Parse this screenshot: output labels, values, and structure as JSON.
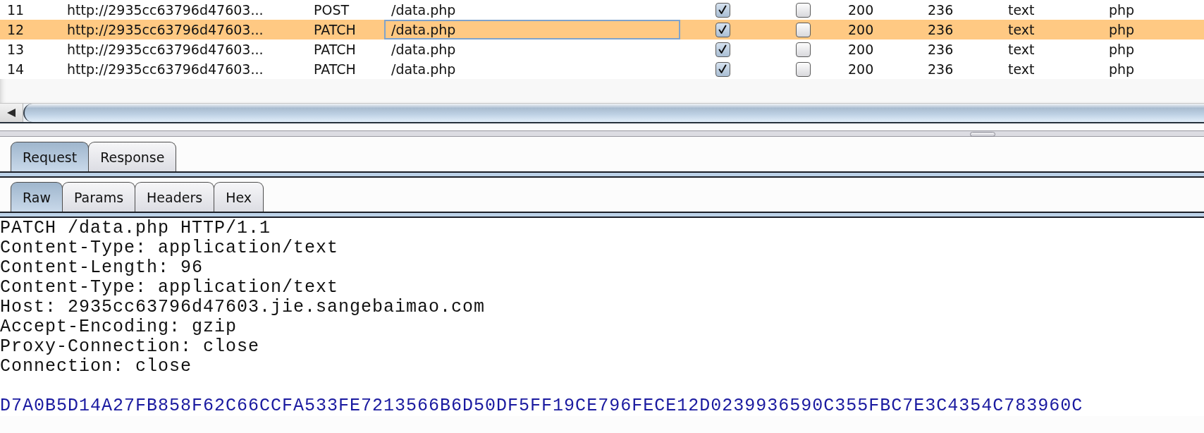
{
  "table": {
    "rows": [
      {
        "selected": false,
        "cells": [
          {
            "kind": "text",
            "text": "11",
            "focused": false
          },
          {
            "kind": "text",
            "text": "http://2935cc63796d47603...",
            "focused": false
          },
          {
            "kind": "text",
            "text": "POST",
            "focused": false
          },
          {
            "kind": "text",
            "text": "/data.php",
            "focused": false
          },
          {
            "kind": "checkbox",
            "checked": true
          },
          {
            "kind": "checkbox",
            "checked": false
          },
          {
            "kind": "text",
            "text": "200",
            "focused": false
          },
          {
            "kind": "text",
            "text": "236",
            "focused": false
          },
          {
            "kind": "text",
            "text": "text",
            "focused": false
          },
          {
            "kind": "text",
            "text": "php",
            "focused": false
          }
        ]
      },
      {
        "selected": true,
        "cells": [
          {
            "kind": "text",
            "text": "12",
            "focused": false
          },
          {
            "kind": "text",
            "text": "http://2935cc63796d47603...",
            "focused": false
          },
          {
            "kind": "text",
            "text": "PATCH",
            "focused": false
          },
          {
            "kind": "text",
            "text": "/data.php",
            "focused": true
          },
          {
            "kind": "checkbox",
            "checked": true
          },
          {
            "kind": "checkbox",
            "checked": false
          },
          {
            "kind": "text",
            "text": "200",
            "focused": false
          },
          {
            "kind": "text",
            "text": "236",
            "focused": false
          },
          {
            "kind": "text",
            "text": "text",
            "focused": false
          },
          {
            "kind": "text",
            "text": "php",
            "focused": false
          }
        ]
      },
      {
        "selected": false,
        "cells": [
          {
            "kind": "text",
            "text": "13",
            "focused": false
          },
          {
            "kind": "text",
            "text": "http://2935cc63796d47603...",
            "focused": false
          },
          {
            "kind": "text",
            "text": "PATCH",
            "focused": false
          },
          {
            "kind": "text",
            "text": "/data.php",
            "focused": false
          },
          {
            "kind": "checkbox",
            "checked": true
          },
          {
            "kind": "checkbox",
            "checked": false
          },
          {
            "kind": "text",
            "text": "200",
            "focused": false
          },
          {
            "kind": "text",
            "text": "236",
            "focused": false
          },
          {
            "kind": "text",
            "text": "text",
            "focused": false
          },
          {
            "kind": "text",
            "text": "php",
            "focused": false
          }
        ]
      },
      {
        "selected": false,
        "cells": [
          {
            "kind": "text",
            "text": "14",
            "focused": false
          },
          {
            "kind": "text",
            "text": "http://2935cc63796d47603...",
            "focused": false
          },
          {
            "kind": "text",
            "text": "PATCH",
            "focused": false
          },
          {
            "kind": "text",
            "text": "/data.php",
            "focused": false
          },
          {
            "kind": "checkbox",
            "checked": true
          },
          {
            "kind": "checkbox",
            "checked": false
          },
          {
            "kind": "text",
            "text": "200",
            "focused": false
          },
          {
            "kind": "text",
            "text": "236",
            "focused": false
          },
          {
            "kind": "text",
            "text": "text",
            "focused": false
          },
          {
            "kind": "text",
            "text": "php",
            "focused": false
          }
        ]
      }
    ]
  },
  "message_tabs": [
    {
      "label": "Request",
      "selected": true
    },
    {
      "label": "Response",
      "selected": false
    }
  ],
  "view_tabs": [
    {
      "label": "Raw",
      "selected": true
    },
    {
      "label": "Params",
      "selected": false
    },
    {
      "label": "Headers",
      "selected": false
    },
    {
      "label": "Hex",
      "selected": false
    }
  ],
  "raw": {
    "lines": [
      "PATCH /data.php HTTP/1.1",
      "Content-Type: application/text",
      "Content-Length: 96",
      "Content-Type: application/text",
      "Host: 2935cc63796d47603.jie.sangebaimao.com",
      "Accept-Encoding: gzip",
      "Proxy-Connection: close",
      "Connection: close"
    ],
    "body": "D7A0B5D14A27FB858F62C66CCFA533FE7213566B6D50DF5FF19CE796FECE12D0239936590C355FBC7E3C4354C783960C"
  }
}
